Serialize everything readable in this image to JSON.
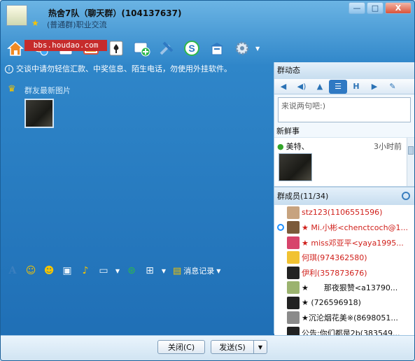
{
  "window": {
    "group_name": "热舍7队（聊天群）(104137637)",
    "group_type": "(普通群)职业交流",
    "minimize": "—",
    "maximize": "□",
    "close": "X"
  },
  "watermark": "bbs.houdao.com",
  "toolbar_icons": [
    "home-icon",
    "chat-icon",
    "share-icon",
    "photo-icon",
    "game-icon",
    "add-app-icon",
    "tools-icon",
    "soso-icon",
    "bulletin-icon",
    "settings-icon"
  ],
  "notice": "交谈中请勿轻信汇款、中奖信息、陌生电话，勿使用外挂软件。",
  "photos_title": "群友最新图片",
  "input_toolbar": {
    "history_label": "消息记录"
  },
  "buttons": {
    "close": "关闭(C)",
    "send": "发送(S)",
    "send_arrow": "▼"
  },
  "right_panel": {
    "header": "群动态",
    "input_placeholder": "来说两句吧:)",
    "fresh_title": "新鲜事",
    "fresh_item_name": "美特、",
    "fresh_item_time": "3小时前",
    "members_header": "群成员(11/34)"
  },
  "members": [
    {
      "name": "stz123(1106551596)",
      "color": "#d0201b",
      "face": "#c7a37f",
      "star": false,
      "status": false
    },
    {
      "name": "★ Mi.小彬<chenctcoch@1...",
      "color": "#d0201b",
      "face": "#7b5a3a",
      "star": true,
      "status": true
    },
    {
      "name": "★ miss邓亚平<yaya1995...",
      "color": "#d0201b",
      "face": "#d7446b",
      "star": true,
      "status": false
    },
    {
      "name": "何琪(974362580)",
      "color": "#d0201b",
      "face": "#f1c232",
      "star": false,
      "status": false
    },
    {
      "name": "伊利(357873676)",
      "color": "#d0201b",
      "face": "#222",
      "star": false,
      "status": false
    },
    {
      "name": "★　　那夜狠赞<a13790...",
      "color": "#111",
      "face": "#9bb36f",
      "star": true,
      "status": false
    },
    {
      "name": "★ (726596918)",
      "color": "#111",
      "face": "#222",
      "star": true,
      "status": false
    },
    {
      "name": "★沉沦烟花美※(8698051...",
      "color": "#111",
      "face": "#8a8a8a",
      "star": true,
      "status": false
    },
    {
      "name": "公告:你们都是2b(383549...",
      "color": "#111",
      "face": "#222",
      "star": false,
      "status": false
    }
  ],
  "colors": {
    "chat_bg": "#1e6db4",
    "accent": "#2f79c3",
    "member_red": "#d0201b"
  }
}
